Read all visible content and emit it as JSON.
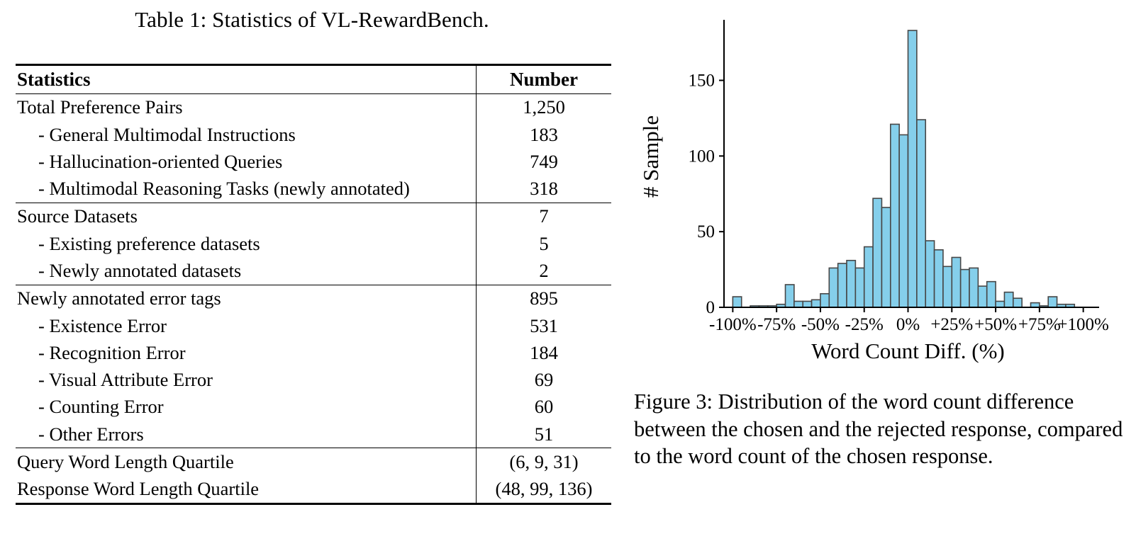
{
  "table": {
    "caption": "Table 1: Statistics of VL-RewardBench.",
    "columns": [
      "Statistics",
      "Number"
    ],
    "groups": [
      {
        "rows": [
          {
            "label": "Total Preference Pairs",
            "value": "1,250",
            "indent": false
          },
          {
            "label": "- General Multimodal Instructions",
            "value": "183",
            "indent": true
          },
          {
            "label": "- Hallucination-oriented Queries",
            "value": "749",
            "indent": true
          },
          {
            "label": "- Multimodal Reasoning Tasks (newly annotated)",
            "value": "318",
            "indent": true
          }
        ]
      },
      {
        "rows": [
          {
            "label": "Source Datasets",
            "value": "7",
            "indent": false
          },
          {
            "label": "- Existing preference datasets",
            "value": "5",
            "indent": true
          },
          {
            "label": "- Newly annotated datasets",
            "value": "2",
            "indent": true
          }
        ]
      },
      {
        "rows": [
          {
            "label": "Newly annotated error tags",
            "value": "895",
            "indent": false
          },
          {
            "label": "- Existence Error",
            "value": "531",
            "indent": true
          },
          {
            "label": "- Recognition Error",
            "value": "184",
            "indent": true
          },
          {
            "label": "- Visual Attribute Error",
            "value": "69",
            "indent": true
          },
          {
            "label": "- Counting Error",
            "value": "60",
            "indent": true
          },
          {
            "label": "- Other Errors",
            "value": "51",
            "indent": true
          }
        ]
      },
      {
        "rows": [
          {
            "label": "Query Word Length Quartile",
            "value": "(6, 9, 31)",
            "indent": false
          },
          {
            "label": "Response Word Length Quartile",
            "value": "(48, 99, 136)",
            "indent": false
          }
        ]
      }
    ]
  },
  "figure": {
    "caption": "Figure 3: Distribution of the word count difference between the chosen and the rejected response, compared to the word count of the chosen response."
  },
  "chart_data": {
    "type": "bar",
    "title": "",
    "xlabel": "Word Count Diff. (%)",
    "ylabel": "# Sample",
    "xlim": [
      -105,
      105
    ],
    "ylim": [
      0,
      190
    ],
    "xticks": [
      -100,
      -75,
      -50,
      -25,
      0,
      25,
      50,
      75,
      100
    ],
    "xtick_labels": [
      "-100%",
      "-75%",
      "-50%",
      "-25%",
      "0%",
      "+25%",
      "+50%",
      "+75%",
      "+100%"
    ],
    "yticks": [
      0,
      50,
      100,
      150
    ],
    "ytick_labels": [
      "0",
      "50",
      "100",
      "150"
    ],
    "grid": false,
    "legend": null,
    "bar_color": "#85cfeb",
    "bar_edge_color": "#474747",
    "bin_width": 5,
    "bin_left_edges": [
      -100,
      -95,
      -90,
      -85,
      -80,
      -75,
      -70,
      -65,
      -60,
      -55,
      -50,
      -45,
      -40,
      -35,
      -30,
      -25,
      -20,
      -15,
      -10,
      -5,
      0,
      5,
      10,
      15,
      20,
      25,
      30,
      35,
      40,
      45,
      50,
      55,
      60,
      65,
      70,
      75,
      80,
      85,
      90,
      95
    ],
    "categories": [
      "-100%",
      "-95%",
      "-90%",
      "-85%",
      "-80%",
      "-75%",
      "-70%",
      "-65%",
      "-60%",
      "-55%",
      "-50%",
      "-45%",
      "-40%",
      "-35%",
      "-30%",
      "-25%",
      "-20%",
      "-15%",
      "-10%",
      "-5%",
      "0%",
      "+5%",
      "+10%",
      "+15%",
      "+20%",
      "+25%",
      "+30%",
      "+35%",
      "+40%",
      "+45%",
      "+50%",
      "+55%",
      "+60%",
      "+65%",
      "+70%",
      "+75%",
      "+80%",
      "+85%",
      "+90%",
      "+95%"
    ],
    "values": [
      7,
      0,
      1,
      1,
      1,
      2,
      15,
      4,
      4,
      5,
      9,
      26,
      29,
      31,
      26,
      40,
      72,
      66,
      121,
      114,
      183,
      124,
      44,
      38,
      27,
      33,
      25,
      26,
      14,
      17,
      4,
      10,
      6,
      0,
      3,
      1,
      7,
      2,
      2,
      0
    ]
  }
}
